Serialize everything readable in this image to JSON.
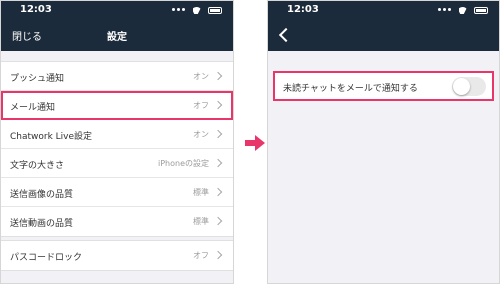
{
  "left_screen": {
    "status_time": "12:03",
    "nav": {
      "close_label": "閉じる",
      "title": "設定"
    },
    "settings": [
      {
        "label": "プッシュ通知",
        "value": "オン"
      },
      {
        "label": "メール通知",
        "value": "オフ",
        "highlighted": true
      },
      {
        "label": "Chatwork Live設定",
        "value": "オン"
      },
      {
        "label": "文字の大きさ",
        "value": "iPhoneの設定"
      },
      {
        "label": "送信画像の品質",
        "value": "標準"
      },
      {
        "label": "送信動画の品質",
        "value": "標準"
      }
    ],
    "passcode": {
      "label": "パスコードロック",
      "value": "オフ"
    }
  },
  "right_screen": {
    "status_time": "12:03",
    "setting": {
      "label": "未読チャットをメールで通知する",
      "toggle_on": false
    }
  },
  "colors": {
    "header": "#1c2b3b",
    "highlight": "#e8366b",
    "background": "#f2f1f6"
  },
  "icons": [
    "more-dots-icon",
    "wifi-icon",
    "battery-icon",
    "chevron-right-icon",
    "back-chevron-icon",
    "arrow-right-icon"
  ]
}
